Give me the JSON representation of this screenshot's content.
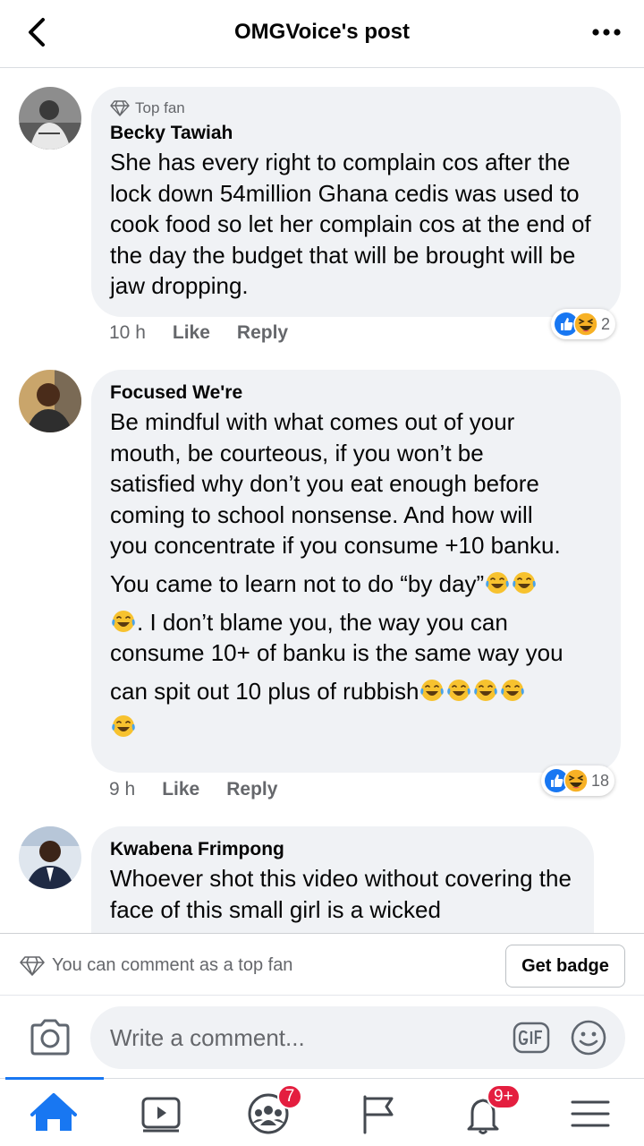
{
  "header": {
    "title": "OMGVoice's post"
  },
  "comments": [
    {
      "badge": "Top fan",
      "author": "Becky Tawiah",
      "text": "She has every right to complain cos after the lock down 54million Ghana cedis was used to cook food so let her complain cos at the end of the day the budget that will be brought will be jaw dropping.",
      "time": "10 h",
      "like": "Like",
      "reply": "Reply",
      "reactions": "2"
    },
    {
      "author": "Focused We're",
      "text_lines": [
        "Be mindful with what comes out of your",
        "mouth, be courteous, if you won’t be",
        "satisfied why don’t you eat enough before",
        "coming to school nonsense. And how will",
        "you concentrate if you consume +10 banku."
      ],
      "text_line6": "You came to learn not to do  “by day”",
      "text_line7": ". I don’t blame you, the way you can",
      "text_line8": "consume 10+ of banku is the same way you",
      "text_line9": "can spit out 10 plus of rubbish",
      "time": "9 h",
      "like": "Like",
      "reply": "Reply",
      "reactions": "18"
    },
    {
      "author": "Kwabena Frimpong",
      "text": "Whoever shot this video without covering the face of this small girl is a wicked"
    }
  ],
  "fanbar": {
    "message": "You can comment as a top fan",
    "button": "Get badge"
  },
  "composer": {
    "placeholder": "Write a comment..."
  },
  "nav": {
    "groups_badge": "7",
    "notifications_badge": "9+"
  },
  "colors": {
    "accent": "#1877f2",
    "bubble": "#f0f2f5",
    "badge_red": "#e41e3f"
  }
}
